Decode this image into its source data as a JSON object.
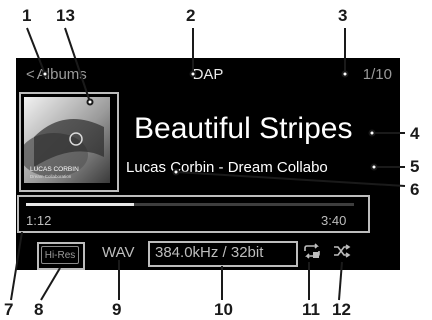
{
  "header": {
    "back_label": "Albums",
    "source": "DAP",
    "track_counter": "1/10"
  },
  "track": {
    "title": "Beautiful Stripes",
    "artist_album": "Lucas Corbin - Dream Collabo",
    "cover_text_line1": "LUCAS CORBIN",
    "cover_text_line2": "Dream Collaboration"
  },
  "progress": {
    "elapsed": "1:12",
    "total": "3:40",
    "fraction": 0.33
  },
  "format": {
    "hires_badge": "Hi-Res",
    "codec": "WAV",
    "sample_rate": "384.0kHz / 32bit"
  },
  "icons": [
    "chevron-left-icon",
    "repeat-icon",
    "shuffle-icon"
  ],
  "callouts": [
    "1",
    "2",
    "3",
    "4",
    "5",
    "6",
    "7",
    "8",
    "9",
    "10",
    "11",
    "12",
    "13"
  ],
  "colors": {
    "screen_bg": "#000000",
    "frame": "#bdbdbd",
    "text": "#ffffff",
    "dim_text": "#9a9a9a"
  }
}
